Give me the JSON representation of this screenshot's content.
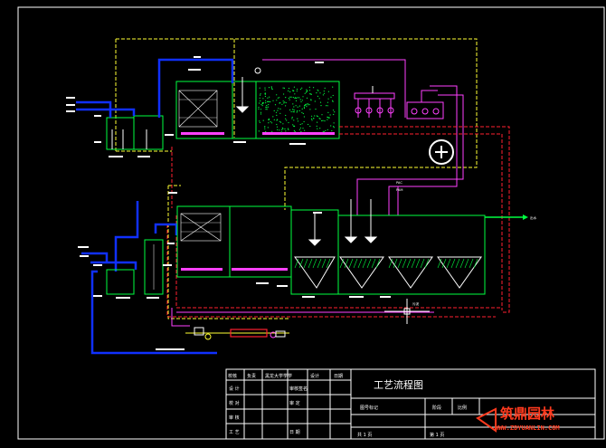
{
  "title_block": {
    "title": "工艺流程图",
    "row1": [
      "校核",
      "负责",
      "黑龙大学学学",
      "设计",
      "日期"
    ],
    "rows": [
      [
        "设  计",
        "",
        "审核签名",
        ""
      ],
      [
        "校  对",
        "",
        "审  定",
        ""
      ],
      [
        "审  核",
        "",
        "",
        ""
      ],
      [
        "工  艺",
        "",
        "日  期",
        ""
      ]
    ],
    "project_label": "图号标记",
    "drawing_no": "共  1  页",
    "sheet_no": "第  1  页",
    "scale_label": "比例",
    "stage_label": "阶段"
  },
  "labels": {
    "outlet": "出水",
    "pac": "PAC",
    "pam": "PAM",
    "sludge": "污泥"
  },
  "watermark": {
    "brand": "筑鼎园林",
    "url": "WWW.ZDYUANLIN.COM"
  },
  "colors": {
    "background": "#000000",
    "water": "#1030ff",
    "tank": "#00ff40",
    "air": "#ffff00",
    "sludge": "#ff2030",
    "chemical": "#ff40ff",
    "dosing": "#00ffff"
  }
}
